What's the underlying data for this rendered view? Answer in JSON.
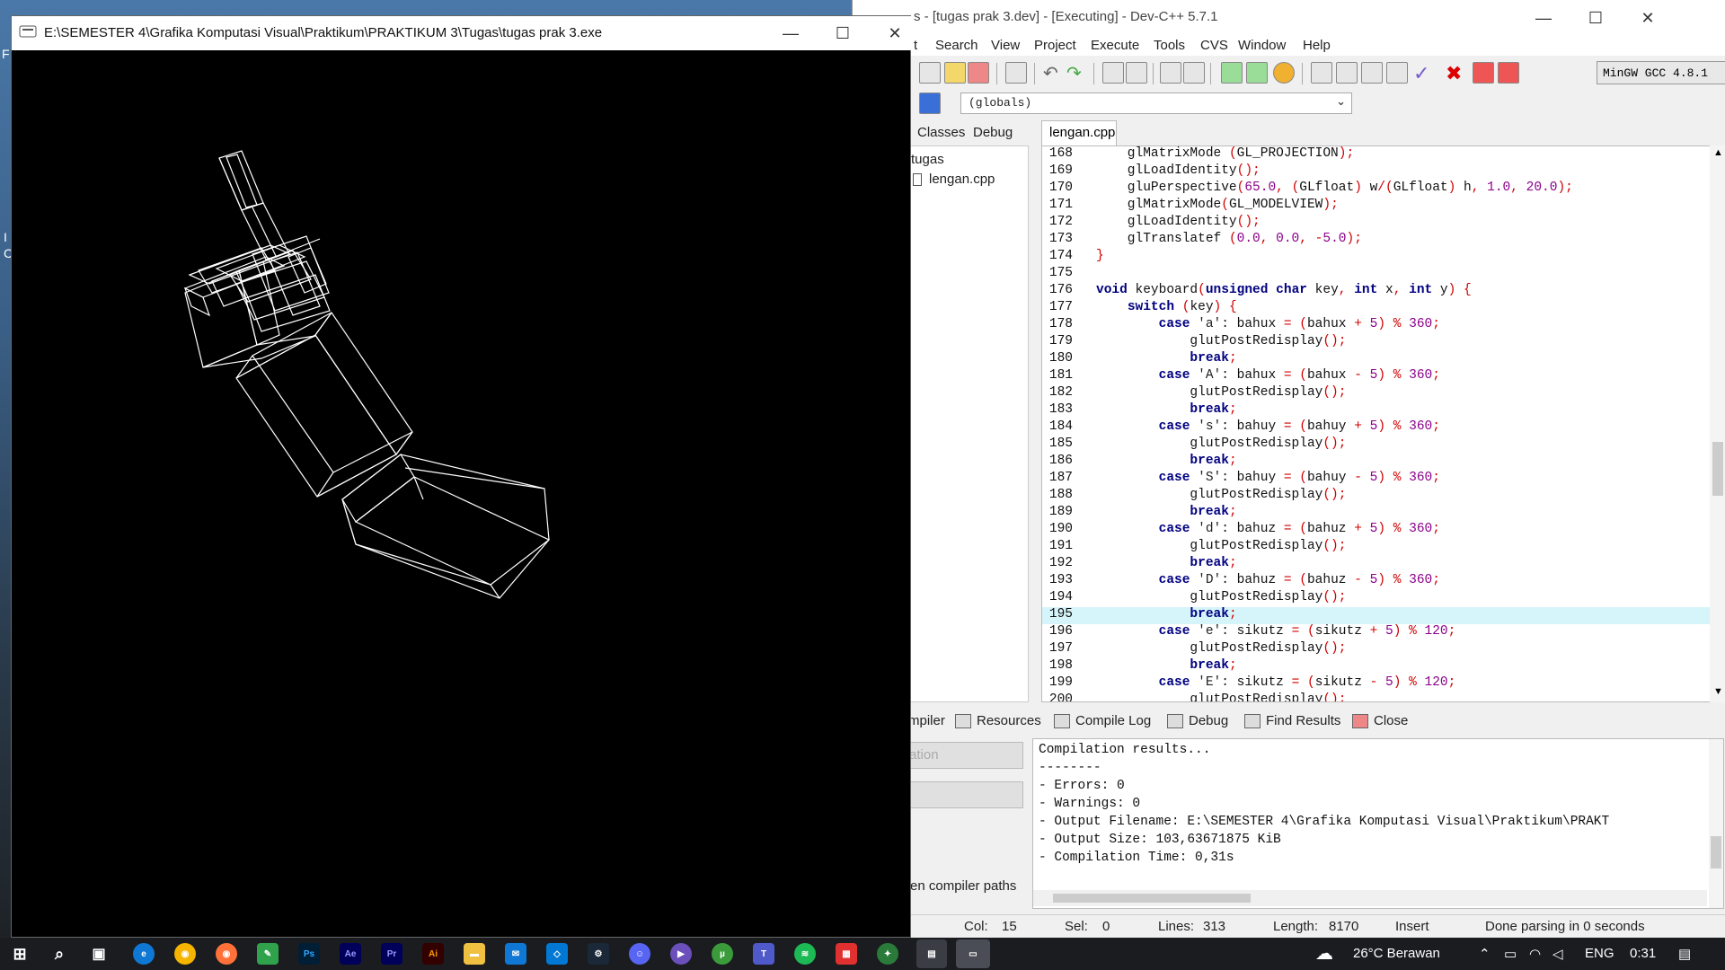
{
  "desktop": {
    "edge_text": [
      "F",
      "I",
      "C"
    ]
  },
  "gl_window": {
    "title": "E:\\SEMESTER 4\\Grafika Komputasi Visual\\Praktikum\\PRAKTIKUM 3\\Tugas\\tugas prak 3.exe",
    "minimize": "—",
    "maximize": "☐",
    "close": "✕"
  },
  "dev_window": {
    "title": "s - [tugas prak 3.dev] - [Executing] - Dev-C++ 5.7.1",
    "minimize": "—",
    "maximize": "☐",
    "close": "✕",
    "menu": [
      "t",
      "Search",
      "View",
      "Project",
      "Execute",
      "Tools",
      "CVS",
      "Window",
      "Help"
    ],
    "compiler": "MinGW GCC 4.8.1",
    "globals": "(globals)",
    "left_tabs": [
      "Classes",
      "Debug"
    ],
    "tree": {
      "project": "tugas",
      "file": "lengan.cpp"
    },
    "editor_tab": "lengan.cpp",
    "code_lines": [
      {
        "n": "168",
        "code": "    glMatrixMode (GL_PROJECTION);"
      },
      {
        "n": "169",
        "code": "    glLoadIdentity();"
      },
      {
        "n": "170",
        "code": "    gluPerspective(65.0, (GLfloat) w/(GLfloat) h, 1.0, 20.0);"
      },
      {
        "n": "171",
        "code": "    glMatrixMode(GL_MODELVIEW);"
      },
      {
        "n": "172",
        "code": "    glLoadIdentity();"
      },
      {
        "n": "173",
        "code": "    glTranslatef (0.0, 0.0, -5.0);"
      },
      {
        "n": "174",
        "code": "}"
      },
      {
        "n": "175",
        "code": ""
      },
      {
        "n": "176",
        "code": "void keyboard(unsigned char key, int x, int y) {"
      },
      {
        "n": "177",
        "code": "    switch (key) {"
      },
      {
        "n": "178",
        "code": "        case 'a': bahux = (bahux + 5) % 360;"
      },
      {
        "n": "179",
        "code": "            glutPostRedisplay();"
      },
      {
        "n": "180",
        "code": "            break;"
      },
      {
        "n": "181",
        "code": "        case 'A': bahux = (bahux - 5) % 360;"
      },
      {
        "n": "182",
        "code": "            glutPostRedisplay();"
      },
      {
        "n": "183",
        "code": "            break;"
      },
      {
        "n": "184",
        "code": "        case 's': bahuy = (bahuy + 5) % 360;"
      },
      {
        "n": "185",
        "code": "            glutPostRedisplay();"
      },
      {
        "n": "186",
        "code": "            break;"
      },
      {
        "n": "187",
        "code": "        case 'S': bahuy = (bahuy - 5) % 360;"
      },
      {
        "n": "188",
        "code": "            glutPostRedisplay();"
      },
      {
        "n": "189",
        "code": "            break;"
      },
      {
        "n": "190",
        "code": "        case 'd': bahuz = (bahuz + 5) % 360;"
      },
      {
        "n": "191",
        "code": "            glutPostRedisplay();"
      },
      {
        "n": "192",
        "code": "            break;"
      },
      {
        "n": "193",
        "code": "        case 'D': bahuz = (bahuz - 5) % 360;"
      },
      {
        "n": "194",
        "code": "            glutPostRedisplay();"
      },
      {
        "n": "195",
        "code": "            break;"
      },
      {
        "n": "196",
        "code": "        case 'e': sikutz = (sikutz + 5) % 120;"
      },
      {
        "n": "197",
        "code": "            glutPostRedisplay();"
      },
      {
        "n": "198",
        "code": "            break;"
      },
      {
        "n": "199",
        "code": "        case 'E': sikutz = (sikutz - 5) % 120;"
      },
      {
        "n": "200",
        "code": "            glutPostRedisplay();"
      }
    ],
    "highlight_line": "195",
    "bottom_tabs": [
      "mpiler",
      "Resources",
      "Compile Log",
      "Debug",
      "Find Results",
      "Close"
    ],
    "abort_button": "rt Compilation",
    "compiler_paths": "en compiler paths",
    "log": [
      "Compilation results...",
      "--------",
      "- Errors: 0",
      "- Warnings: 0",
      "- Output Filename: E:\\SEMESTER 4\\Grafika Komputasi Visual\\Praktikum\\PRAKT",
      "- Output Size: 103,63671875 KiB",
      "- Compilation Time: 0,31s"
    ],
    "status": {
      "col_label": "Col:",
      "col": "15",
      "sel_label": "Sel:",
      "sel": "0",
      "lines_label": "Lines:",
      "lines": "313",
      "length_label": "Length:",
      "length": "8170",
      "mode": "Insert",
      "parse": "Done parsing in 0 seconds"
    }
  },
  "taskbar": {
    "weather": "26°C  Berawan",
    "lang": "ENG",
    "time": "0:31"
  },
  "colors": {
    "keyword": "#000080",
    "number": "#8b008b",
    "highlight": "#d6f5fb"
  }
}
